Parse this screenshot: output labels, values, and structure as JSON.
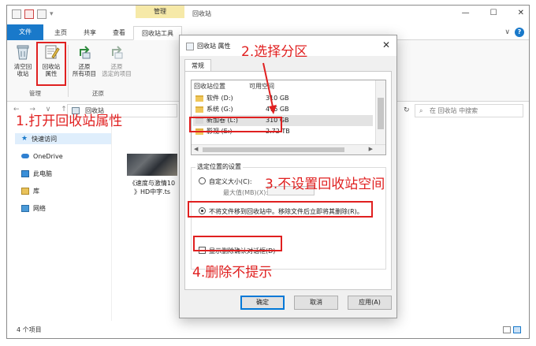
{
  "titlebar": {
    "context_tab": "管理",
    "window_title": "回收站",
    "controls": [
      "—",
      "☐",
      "✕"
    ]
  },
  "tabs": {
    "file": "文件",
    "home": "主页",
    "share": "共享",
    "view": "查看",
    "tools": "回收站工具"
  },
  "ribbon": {
    "empty_line1": "清空回",
    "empty_line2": "收站",
    "props_line1": "回收站",
    "props_line2": "属性",
    "restore_all_line1": "还原",
    "restore_all_line2": "所有项目",
    "restore_sel_line1": "还原",
    "restore_sel_line2": "选定的项目",
    "group_manage": "管理",
    "group_restore": "还原"
  },
  "address": {
    "nav": "← → ∨ ↑",
    "location": "回收站",
    "search_placeholder": "在 回收站 中搜索"
  },
  "sidebar": {
    "items": [
      {
        "label": "快速访问"
      },
      {
        "label": "OneDrive"
      },
      {
        "label": "此电脑"
      },
      {
        "label": "库"
      },
      {
        "label": "网络"
      }
    ]
  },
  "files": [
    {
      "name_line1": "《速度与激情10",
      "name_line2": "》HD中字.ts"
    }
  ],
  "status": {
    "count": "4 个项目"
  },
  "dialog": {
    "title": "回收站 属性",
    "close": "✕",
    "tab": "常规",
    "col_location": "回收站位置",
    "col_space": "可用空间",
    "volumes": [
      {
        "name": "软件 (D:)",
        "space": "310 GB"
      },
      {
        "name": "系统 (G:)",
        "space": "476 GB"
      },
      {
        "name": "新加卷 (L:)",
        "space": "310 GB"
      },
      {
        "name": "影视 (E:)",
        "space": "2.72 TB"
      }
    ],
    "settings_label": "选定位置的设置",
    "custom_size": "自定义大小(C):",
    "max_value": "最大值(MB)(X):",
    "max_value_input": "",
    "no_recycle": "不将文件移到回收站中。移除文件后立即将其删除(R)。",
    "show_confirm": "显示删除确认对话框(D)",
    "ok": "确定",
    "cancel": "取消",
    "apply": "应用(A)"
  },
  "annotations": {
    "step1": "1.打开回收站属性",
    "step2": "2.选择分区",
    "step3": "3.不设置回收站空间",
    "step4": "4.删除不提示",
    "color": "#e02020"
  }
}
